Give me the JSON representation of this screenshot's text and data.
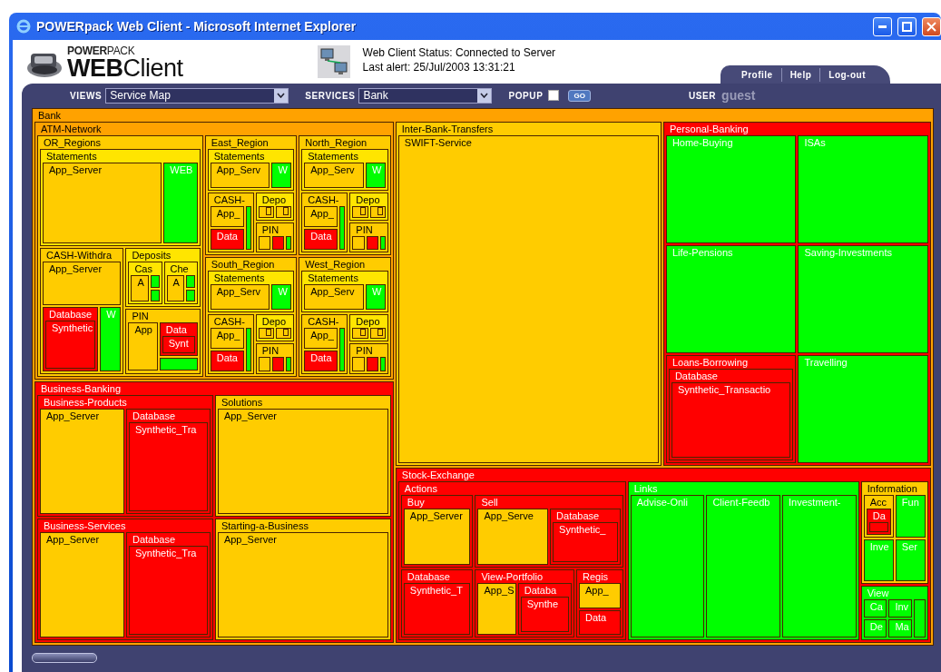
{
  "window": {
    "title": "POWERpack Web Client - Microsoft Internet Explorer"
  },
  "header": {
    "logo_top": "**POWER**PACK",
    "logo_main": "**WEB**Client",
    "status_line": "Web Client Status: Connected to Server",
    "alert_line": "Last alert: 25/Jul/2003 13:31:21",
    "tabs": [
      {
        "label": "Profile"
      },
      {
        "label": "Help"
      },
      {
        "label": "Log-out"
      }
    ]
  },
  "toolbar": {
    "views_label": "VIEWS",
    "views_value": "Service Map",
    "services_label": "SERVICES",
    "services_value": "Bank",
    "popup_label": "POPUP",
    "popup_checked": false,
    "go_label": "GO",
    "user_label": "USER",
    "user_name": "guest"
  },
  "treemap": {
    "root": {
      "label": "Bank",
      "color": "#ffa200",
      "children": [
        {
          "label": "ATM-Network",
          "color": "#ffa200",
          "children": [
            {
              "label": "OR_Regions",
              "color": "#ffcc00",
              "children": [
                {
                  "label": "Statements",
                  "color": "#ffe500",
                  "children": [
                    {
                      "label": "App_Server",
                      "color": "#ffcc00"
                    },
                    {
                      "label": "WEB",
                      "color": "#00ff00"
                    }
                  ]
                },
                {
                  "label": "CASH-Withdra",
                  "color": "#ffcc00",
                  "children": [
                    {
                      "label": "App_Server",
                      "color": "#ffcc00"
                    },
                    {
                      "label": "Database",
                      "color": "#ff0000",
                      "children": [
                        {
                          "label": "Synthetic",
                          "color": "#ff0000"
                        }
                      ]
                    },
                    {
                      "label": "W",
                      "color": "#00ff00"
                    }
                  ]
                },
                {
                  "label": "Deposits",
                  "color": "#ffe500",
                  "children": [
                    {
                      "label": "Cas",
                      "color": "#ffe500",
                      "children": [
                        {
                          "label": "A",
                          "color": "#ffcc00"
                        },
                        {
                          "color": "#00ff00"
                        },
                        {
                          "color": "#00ff00"
                        }
                      ]
                    },
                    {
                      "label": "Che",
                      "color": "#ffe500",
                      "children": [
                        {
                          "label": "A",
                          "color": "#ffcc00"
                        },
                        {
                          "color": "#00ff00"
                        },
                        {
                          "color": "#00ff00"
                        }
                      ]
                    }
                  ]
                },
                {
                  "label": "PIN",
                  "color": "#ffcc00",
                  "children": [
                    {
                      "label": "App",
                      "color": "#ffcc00"
                    },
                    {
                      "label": "Data",
                      "color": "#ff0000",
                      "children": [
                        {
                          "label": "Synt",
                          "color": "#ff0000"
                        }
                      ]
                    },
                    {
                      "color": "#00ff00"
                    }
                  ]
                }
              ]
            },
            {
              "label": "East_Region",
              "color": "#ffcc00",
              "children": [
                {
                  "label": "Statements",
                  "color": "#ffe500",
                  "children": [
                    {
                      "label": "App_Serv",
                      "color": "#ffcc00"
                    },
                    {
                      "label": "W",
                      "color": "#00ff00"
                    }
                  ]
                },
                {
                  "label": "CASH-",
                  "color": "#ffcc00",
                  "children": [
                    {
                      "label": "App_",
                      "color": "#ffcc00"
                    },
                    {
                      "label": "Data",
                      "color": "#ff0000"
                    },
                    {
                      "color": "#00ff00"
                    }
                  ]
                },
                {
                  "label": "Depo",
                  "color": "#ffe500",
                  "children": [
                    {
                      "color": "#ffcc00",
                      "children": [
                        {
                          "color": "#ffcc00"
                        }
                      ]
                    },
                    {
                      "color": "#ffcc00",
                      "children": [
                        {
                          "color": "#ffcc00"
                        }
                      ]
                    }
                  ]
                },
                {
                  "label": "PIN",
                  "color": "#ffcc00",
                  "children": [
                    {
                      "color": "#ffcc00"
                    },
                    {
                      "color": "#ff0000"
                    },
                    {
                      "color": "#00ff00"
                    }
                  ]
                }
              ]
            },
            {
              "label": "North_Region",
              "color": "#ffcc00",
              "children": [
                {
                  "label": "Statements",
                  "color": "#ffe500",
                  "children": [
                    {
                      "label": "App_Serv",
                      "color": "#ffcc00"
                    },
                    {
                      "label": "W",
                      "color": "#00ff00"
                    }
                  ]
                },
                {
                  "label": "CASH-",
                  "color": "#ffcc00",
                  "children": [
                    {
                      "label": "App_",
                      "color": "#ffcc00"
                    },
                    {
                      "label": "Data",
                      "color": "#ff0000"
                    },
                    {
                      "color": "#00ff00"
                    }
                  ]
                },
                {
                  "label": "Depo",
                  "color": "#ffe500",
                  "children": [
                    {
                      "color": "#ffcc00",
                      "children": [
                        {
                          "color": "#ffcc00"
                        }
                      ]
                    },
                    {
                      "color": "#ffcc00",
                      "children": [
                        {
                          "color": "#ffcc00"
                        }
                      ]
                    }
                  ]
                },
                {
                  "label": "PIN",
                  "color": "#ffcc00",
                  "children": [
                    {
                      "color": "#ffcc00"
                    },
                    {
                      "color": "#ff0000"
                    },
                    {
                      "color": "#00ff00"
                    }
                  ]
                }
              ]
            },
            {
              "label": "South_Region",
              "color": "#ffcc00",
              "children": [
                {
                  "label": "Statements",
                  "color": "#ffe500",
                  "children": [
                    {
                      "label": "App_Serv",
                      "color": "#ffcc00"
                    },
                    {
                      "label": "W",
                      "color": "#00ff00"
                    }
                  ]
                },
                {
                  "label": "CASH-",
                  "color": "#ffcc00",
                  "children": [
                    {
                      "label": "App_",
                      "color": "#ffcc00"
                    },
                    {
                      "label": "Data",
                      "color": "#ff0000"
                    },
                    {
                      "color": "#00ff00"
                    }
                  ]
                },
                {
                  "label": "Depo",
                  "color": "#ffe500",
                  "children": [
                    {
                      "color": "#ffcc00",
                      "children": [
                        {
                          "color": "#ffcc00"
                        }
                      ]
                    },
                    {
                      "color": "#ffcc00",
                      "children": [
                        {
                          "color": "#ffcc00"
                        }
                      ]
                    }
                  ]
                },
                {
                  "label": "PIN",
                  "color": "#ffcc00",
                  "children": [
                    {
                      "color": "#ffcc00"
                    },
                    {
                      "color": "#ff0000"
                    },
                    {
                      "color": "#00ff00"
                    }
                  ]
                }
              ]
            },
            {
              "label": "West_Region",
              "color": "#ffcc00",
              "children": [
                {
                  "label": "Statements",
                  "color": "#ffe500",
                  "children": [
                    {
                      "label": "App_Serv",
                      "color": "#ffcc00"
                    },
                    {
                      "label": "W",
                      "color": "#00ff00"
                    }
                  ]
                },
                {
                  "label": "CASH-",
                  "color": "#ffcc00",
                  "children": [
                    {
                      "label": "App_",
                      "color": "#ffcc00"
                    },
                    {
                      "label": "Data",
                      "color": "#ff0000"
                    },
                    {
                      "color": "#00ff00"
                    }
                  ]
                },
                {
                  "label": "Depo",
                  "color": "#ffe500",
                  "children": [
                    {
                      "color": "#ffcc00",
                      "children": [
                        {
                          "color": "#ffcc00"
                        }
                      ]
                    },
                    {
                      "color": "#ffcc00",
                      "children": [
                        {
                          "color": "#ffcc00"
                        }
                      ]
                    }
                  ]
                },
                {
                  "label": "PIN",
                  "color": "#ffcc00",
                  "children": [
                    {
                      "color": "#ffcc00"
                    },
                    {
                      "color": "#ff0000"
                    },
                    {
                      "color": "#00ff00"
                    }
                  ]
                }
              ]
            }
          ]
        },
        {
          "label": "Business-Banking",
          "color": "#ff0000",
          "children": [
            {
              "label": "Business-Products",
              "color": "#ff0000",
              "children": [
                {
                  "label": "App_Server",
                  "color": "#ffcc00"
                },
                {
                  "label": "Database",
                  "color": "#ff0000",
                  "children": [
                    {
                      "label": "Synthetic_Tra",
                      "color": "#ff0000"
                    }
                  ]
                }
              ]
            },
            {
              "label": "Solutions",
              "color": "#ffcc00",
              "children": [
                {
                  "label": "App_Server",
                  "color": "#ffcc00"
                }
              ]
            },
            {
              "label": "Business-Services",
              "color": "#ff0000",
              "children": [
                {
                  "label": "App_Server",
                  "color": "#ffcc00"
                },
                {
                  "label": "Database",
                  "color": "#ff0000",
                  "children": [
                    {
                      "label": "Synthetic_Tra",
                      "color": "#ff0000"
                    }
                  ]
                }
              ]
            },
            {
              "label": "Starting-a-Business",
              "color": "#ffcc00",
              "children": [
                {
                  "label": "App_Server",
                  "color": "#ffcc00"
                }
              ]
            }
          ]
        },
        {
          "label": "Inter-Bank-Transfers",
          "color": "#ffcc00",
          "children": [
            {
              "label": "SWIFT-Service",
              "color": "#ffcc00"
            }
          ]
        },
        {
          "label": "Personal-Banking",
          "color": "#ff0000",
          "children": [
            {
              "label": "Home-Buying",
              "color": "#00ff00"
            },
            {
              "label": "ISAs",
              "color": "#00ff00"
            },
            {
              "label": "Life-Pensions",
              "color": "#00ff00"
            },
            {
              "label": "Saving-Investments",
              "color": "#00ff00"
            },
            {
              "label": "Loans-Borrowing",
              "color": "#ff0000",
              "children": [
                {
                  "label": "Database",
                  "color": "#ff0000",
                  "children": [
                    {
                      "label": "Synthetic_Transactio",
                      "color": "#ff0000"
                    }
                  ]
                }
              ]
            },
            {
              "label": "Travelling",
              "color": "#00ff00"
            }
          ]
        },
        {
          "label": "Stock-Exchange",
          "color": "#ff0000",
          "children": [
            {
              "label": "Actions",
              "color": "#ff0000",
              "children": [
                {
                  "label": "Buy",
                  "color": "#ff0000",
                  "children": [
                    {
                      "label": "App_Server",
                      "color": "#ffcc00"
                    }
                  ]
                },
                {
                  "label": "Sell",
                  "color": "#ff0000",
                  "children": [
                    {
                      "label": "App_Serve",
                      "color": "#ffcc00"
                    },
                    {
                      "label": "Database",
                      "color": "#ff0000",
                      "children": [
                        {
                          "label": "Synthetic_",
                          "color": "#ff0000"
                        }
                      ]
                    }
                  ]
                },
                {
                  "label": "Database",
                  "color": "#ff0000",
                  "children": [
                    {
                      "label": "Synthetic_T",
                      "color": "#ff0000"
                    }
                  ]
                },
                {
                  "label": "View-Portfolio",
                  "color": "#ff0000",
                  "children": [
                    {
                      "label": "App_S",
                      "color": "#ffcc00"
                    },
                    {
                      "label": "Databa",
                      "color": "#ff0000",
                      "children": [
                        {
                          "label": "Synthe",
                          "color": "#ff0000"
                        }
                      ]
                    }
                  ]
                },
                {
                  "label": "Regis",
                  "color": "#ff0000",
                  "children": [
                    {
                      "label": "App_",
                      "color": "#ffcc00"
                    },
                    {
                      "label": "Data",
                      "color": "#ff0000"
                    }
                  ]
                }
              ]
            },
            {
              "label": "Links",
              "color": "#00ff00",
              "children": [
                {
                  "label": "Advise-Onli",
                  "color": "#00ff00"
                },
                {
                  "label": "Client-Feedb",
                  "color": "#00ff00"
                },
                {
                  "label": "Investment-",
                  "color": "#00ff00"
                }
              ]
            },
            {
              "label": "Information",
              "color": "#ffcc00",
              "children": [
                {
                  "label": "Acc",
                  "color": "#ffcc00",
                  "children": [
                    {
                      "label": "Da",
                      "color": "#ff0000",
                      "children": [
                        {
                          "color": "#ff0000"
                        }
                      ]
                    }
                  ]
                },
                {
                  "label": "Fun",
                  "color": "#00ff00"
                },
                {
                  "label": "Inve",
                  "color": "#00ff00"
                },
                {
                  "label": "Ser",
                  "color": "#00ff00"
                }
              ]
            },
            {
              "label": "View",
              "color": "#00ff00",
              "children": [
                {
                  "label": "Ca",
                  "color": "#00ff00"
                },
                {
                  "label": "Inv",
                  "color": "#00ff00"
                },
                {
                  "color": "#00ff00"
                },
                {
                  "label": "De",
                  "color": "#00ff00"
                },
                {
                  "label": "Ma",
                  "color": "#00ff00"
                }
              ]
            }
          ]
        }
      ]
    }
  }
}
